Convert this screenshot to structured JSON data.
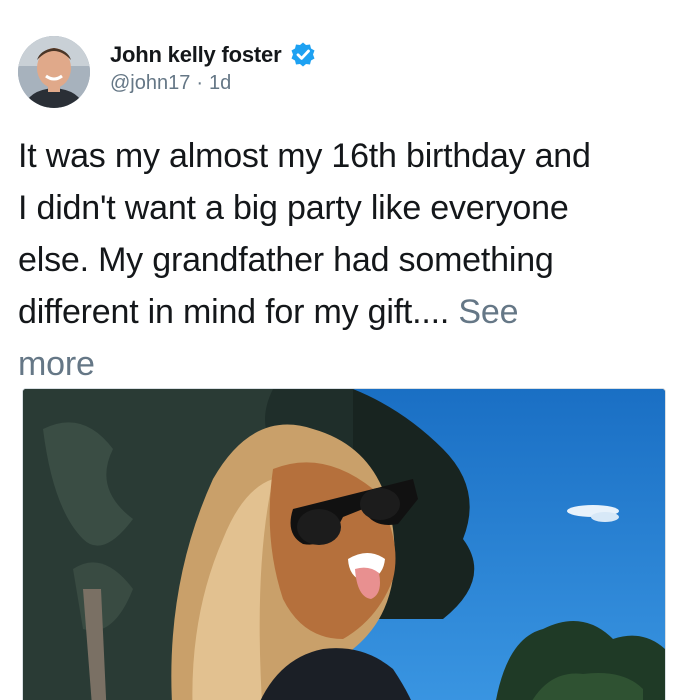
{
  "author": {
    "display_name": "John kelly foster",
    "handle": "@john17",
    "separator": "·",
    "time": "1d",
    "avatar_icon": "user-avatar-photo",
    "verified_icon": "verified-badge-icon"
  },
  "tweet": {
    "text_lines": [
      "It was my almost my 16th birthday and",
      "I didn't want a big party like everyone",
      "else. My grandfather had something",
      "different in mind for my gift...."
    ],
    "see_more_part1": "See",
    "see_more_part2": "more"
  },
  "media": {
    "image_icon": "photo-girl-sunglasses-tongue-out"
  },
  "colors": {
    "text": "#14171a",
    "muted": "#657786",
    "verified": "#1da1f2",
    "sky": "#1f7fd0"
  }
}
